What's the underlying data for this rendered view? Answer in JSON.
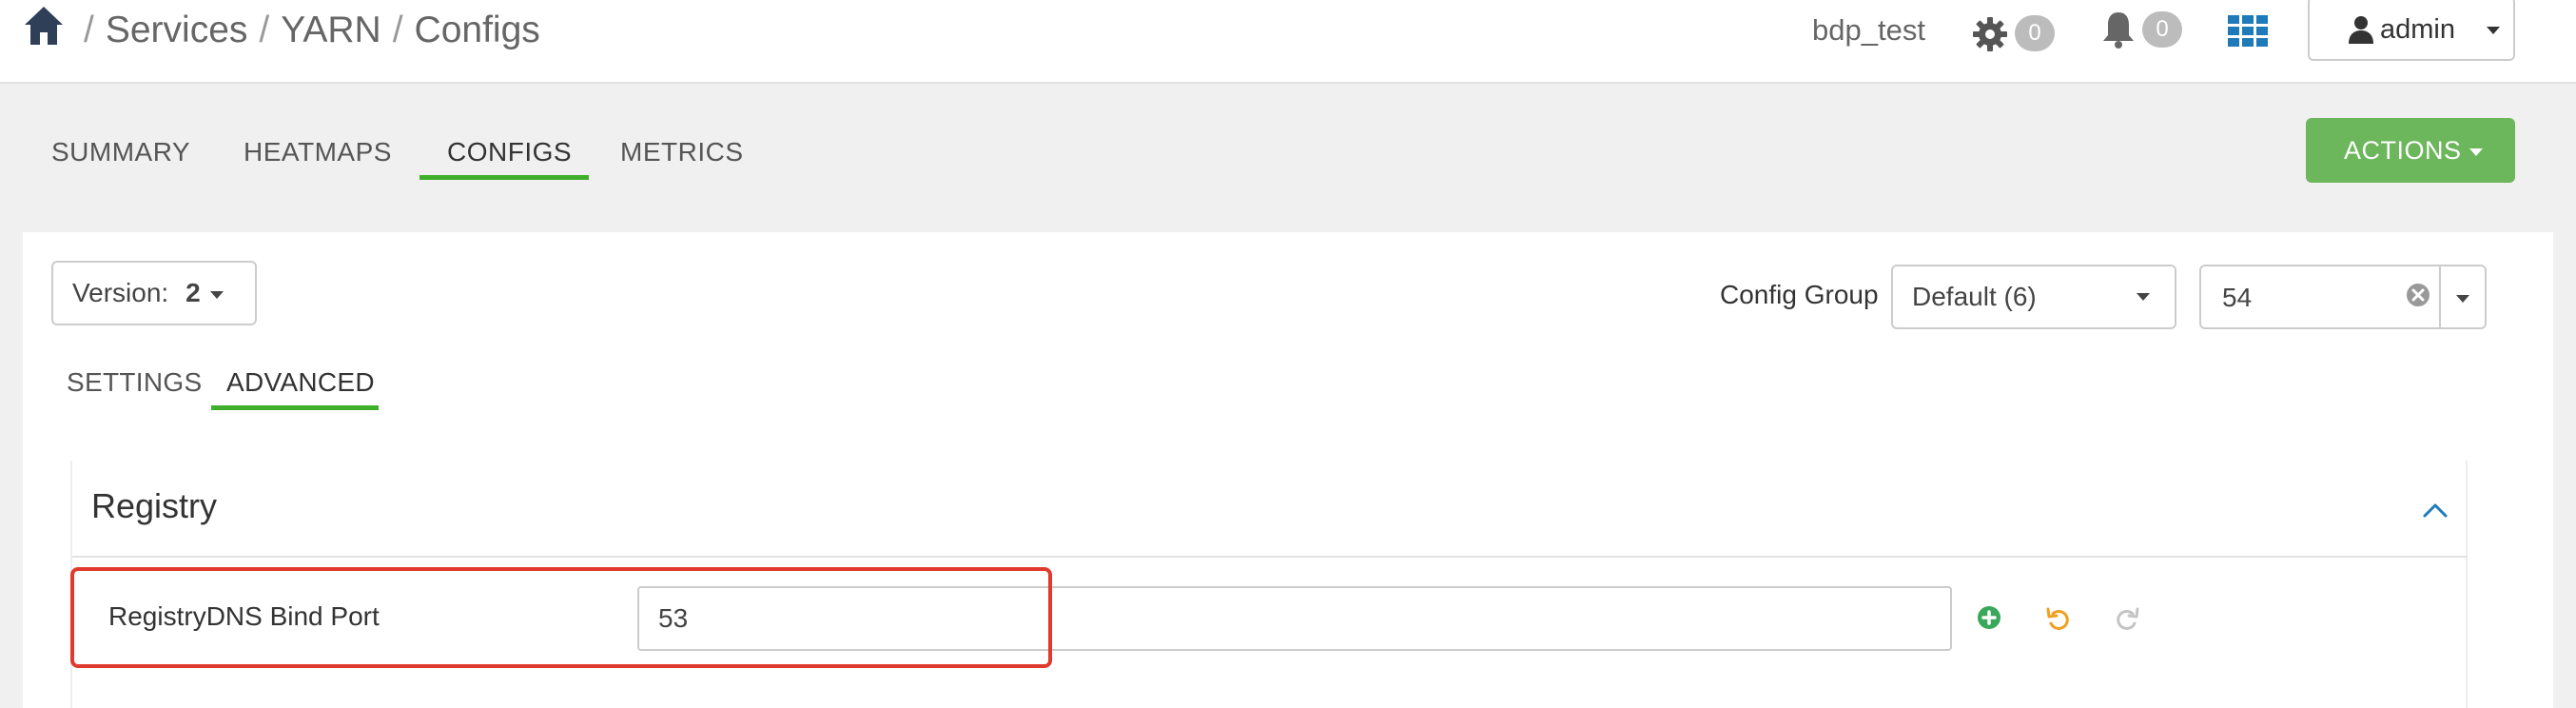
{
  "breadcrumb": {
    "items": [
      "Services",
      "YARN",
      "Configs"
    ],
    "separator": "/"
  },
  "header": {
    "cluster_name": "bdp_test",
    "ops_count": "0",
    "alerts_count": "0",
    "user_label": "admin"
  },
  "service_tabs": [
    {
      "label": "SUMMARY",
      "active": false
    },
    {
      "label": "HEATMAPS",
      "active": false
    },
    {
      "label": "CONFIGS",
      "active": true
    },
    {
      "label": "METRICS",
      "active": false
    }
  ],
  "actions_label": "ACTIONS",
  "version": {
    "label": "Version:",
    "value": "2"
  },
  "config_group": {
    "label": "Config Group",
    "selected": "Default (6)",
    "host_value": "54"
  },
  "sub_tabs": [
    {
      "label": "SETTINGS",
      "active": false
    },
    {
      "label": "ADVANCED",
      "active": true
    }
  ],
  "section": {
    "title": "Registry",
    "properties": [
      {
        "label": "RegistryDNS Bind Port",
        "value": "53"
      }
    ]
  },
  "colors": {
    "accent_green": "#3fae2a",
    "actions_button": "#6cb65c",
    "highlight_red": "#e03a2f",
    "link_blue": "#1e7ab8"
  },
  "icons": [
    "home-icon",
    "gear-icon",
    "bell-icon",
    "grid-icon",
    "user-icon",
    "clear-icon",
    "chevron-up-icon",
    "add-icon",
    "undo-icon",
    "redo-icon"
  ]
}
